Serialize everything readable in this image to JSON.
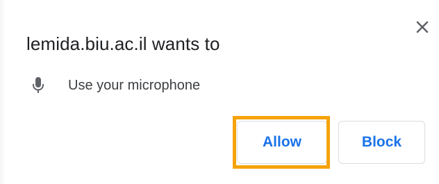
{
  "dialog": {
    "title": "lemida.biu.ac.il wants to",
    "close_icon": "close-icon",
    "permission": {
      "icon": "microphone-icon",
      "label": "Use your microphone"
    },
    "buttons": {
      "allow_label": "Allow",
      "block_label": "Block"
    }
  },
  "colors": {
    "accent": "#1a73e8",
    "highlight": "#f5a30a",
    "text": "#202124",
    "icon": "#5f6368"
  }
}
